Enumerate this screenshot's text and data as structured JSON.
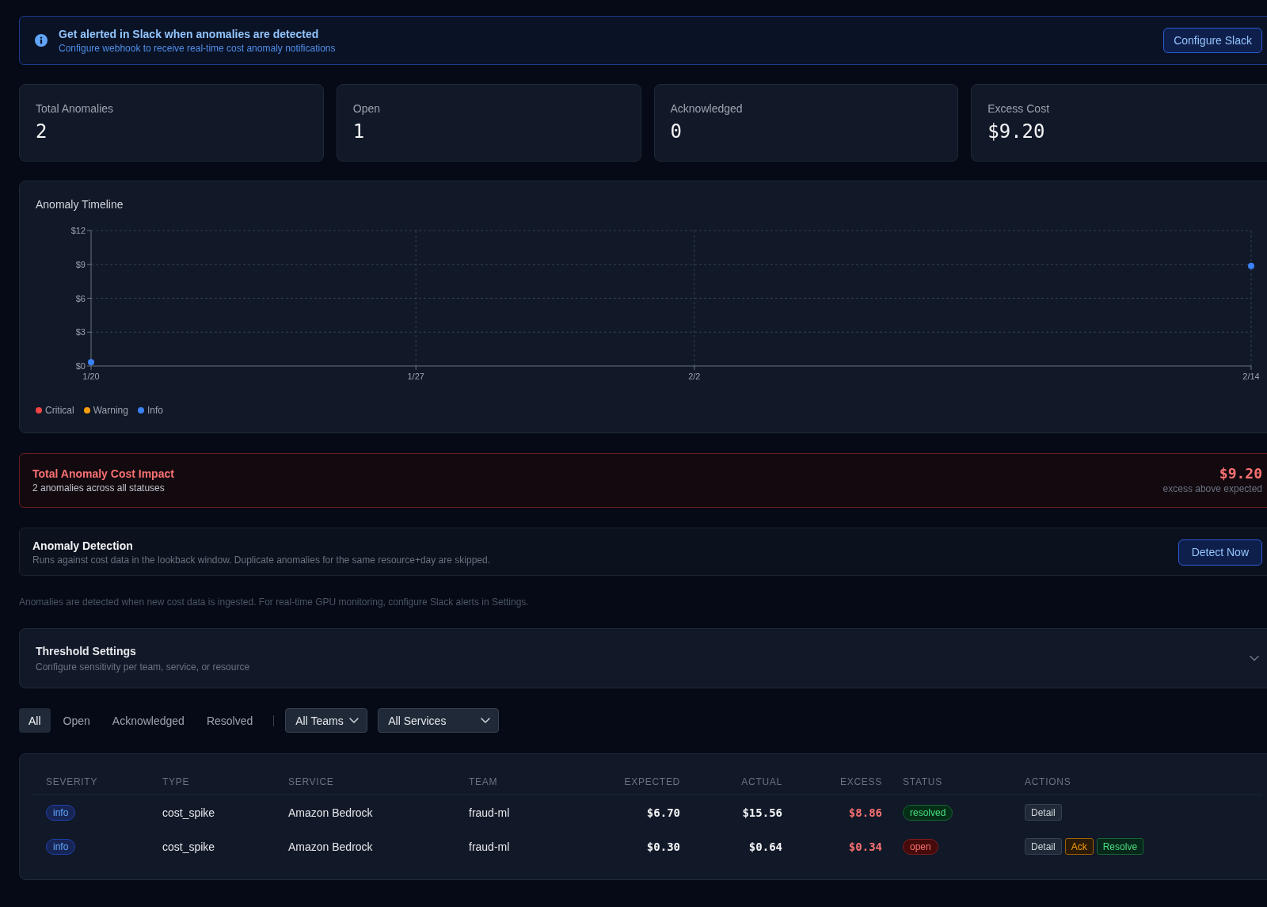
{
  "banner": {
    "title": "Get alerted in Slack when anomalies are detected",
    "subtitle": "Configure webhook to receive real-time cost anomaly notifications",
    "button": "Configure Slack"
  },
  "stats": [
    {
      "label": "Total Anomalies",
      "value": "2"
    },
    {
      "label": "Open",
      "value": "1"
    },
    {
      "label": "Acknowledged",
      "value": "0"
    },
    {
      "label": "Excess Cost",
      "value": "$9.20"
    }
  ],
  "timeline": {
    "chart_data": [
      {
        "type": "scatter",
        "title": "Anomaly Timeline",
        "xlim": [
          "--01-20",
          "--02-14"
        ],
        "xticks": [
          {
            "value": "--01-20",
            "label": "1/20"
          },
          {
            "value": "--01-27",
            "label": "1/27"
          },
          {
            "value": "--02-02",
            "label": "2/2"
          },
          {
            "value": "--02-14",
            "label": "2/14"
          }
        ],
        "ylim": [
          0,
          12
        ],
        "yticks": [
          {
            "value": 0,
            "label": "$0"
          },
          {
            "value": 3,
            "label": "$3"
          },
          {
            "value": 6,
            "label": "$6"
          },
          {
            "value": 9,
            "label": "$9"
          },
          {
            "value": 12,
            "label": "$12"
          }
        ],
        "grid": true,
        "legend": "bottom",
        "series": [
          {
            "name": "Critical",
            "color": "#ef4444"
          },
          {
            "name": "Warning",
            "color": "#f59e0b"
          },
          {
            "name": "Info",
            "color": "#3b82f6",
            "x": [
              "--01-20",
              "--02-14"
            ],
            "values": [
              0.34,
              8.86
            ]
          }
        ]
      }
    ]
  },
  "cost_impact": {
    "title": "Total Anomaly Cost Impact",
    "subtitle": "2 anomalies across all statuses",
    "amount": "$9.20",
    "amount_caption": "excess above expected"
  },
  "detection": {
    "title": "Anomaly Detection",
    "description": "Runs against cost data in the lookback window. Duplicate anomalies for the same resource+day are skipped.",
    "button": "Detect Now"
  },
  "note": "Anomalies are detected when new cost data is ingested. For real-time GPU monitoring, configure Slack alerts in Settings.",
  "threshold_settings": {
    "title": "Threshold Settings",
    "subtitle": "Configure sensitivity per team, service, or resource",
    "expanded": false
  },
  "filters": {
    "tabs": [
      {
        "label": "All",
        "selected": true
      },
      {
        "label": "Open",
        "selected": false
      },
      {
        "label": "Acknowledged",
        "selected": false
      },
      {
        "label": "Resolved",
        "selected": false
      }
    ],
    "dropdowns": [
      {
        "value": "All Teams"
      },
      {
        "value": "All Services"
      }
    ]
  },
  "table": {
    "columns": [
      "SEVERITY",
      "TYPE",
      "SERVICE",
      "TEAM",
      "EXPECTED",
      "ACTUAL",
      "EXCESS",
      "STATUS",
      "ACTIONS"
    ],
    "rows": [
      {
        "severity": {
          "label": "info",
          "kind": "info"
        },
        "type": "cost_spike",
        "service": "Amazon Bedrock",
        "team": "fraud-ml",
        "expected": "$6.70",
        "actual": "$15.56",
        "excess": "$8.86",
        "status": {
          "label": "resolved",
          "kind": "resolved"
        },
        "actions": [
          {
            "label": "Detail",
            "kind": "detail"
          }
        ]
      },
      {
        "severity": {
          "label": "info",
          "kind": "info"
        },
        "type": "cost_spike",
        "service": "Amazon Bedrock",
        "team": "fraud-ml",
        "expected": "$0.30",
        "actual": "$0.64",
        "excess": "$0.34",
        "status": {
          "label": "open",
          "kind": "open"
        },
        "actions": [
          {
            "label": "Detail",
            "kind": "detail"
          },
          {
            "label": "Ack",
            "kind": "ack"
          },
          {
            "label": "Resolve",
            "kind": "resolve"
          }
        ]
      }
    ]
  }
}
